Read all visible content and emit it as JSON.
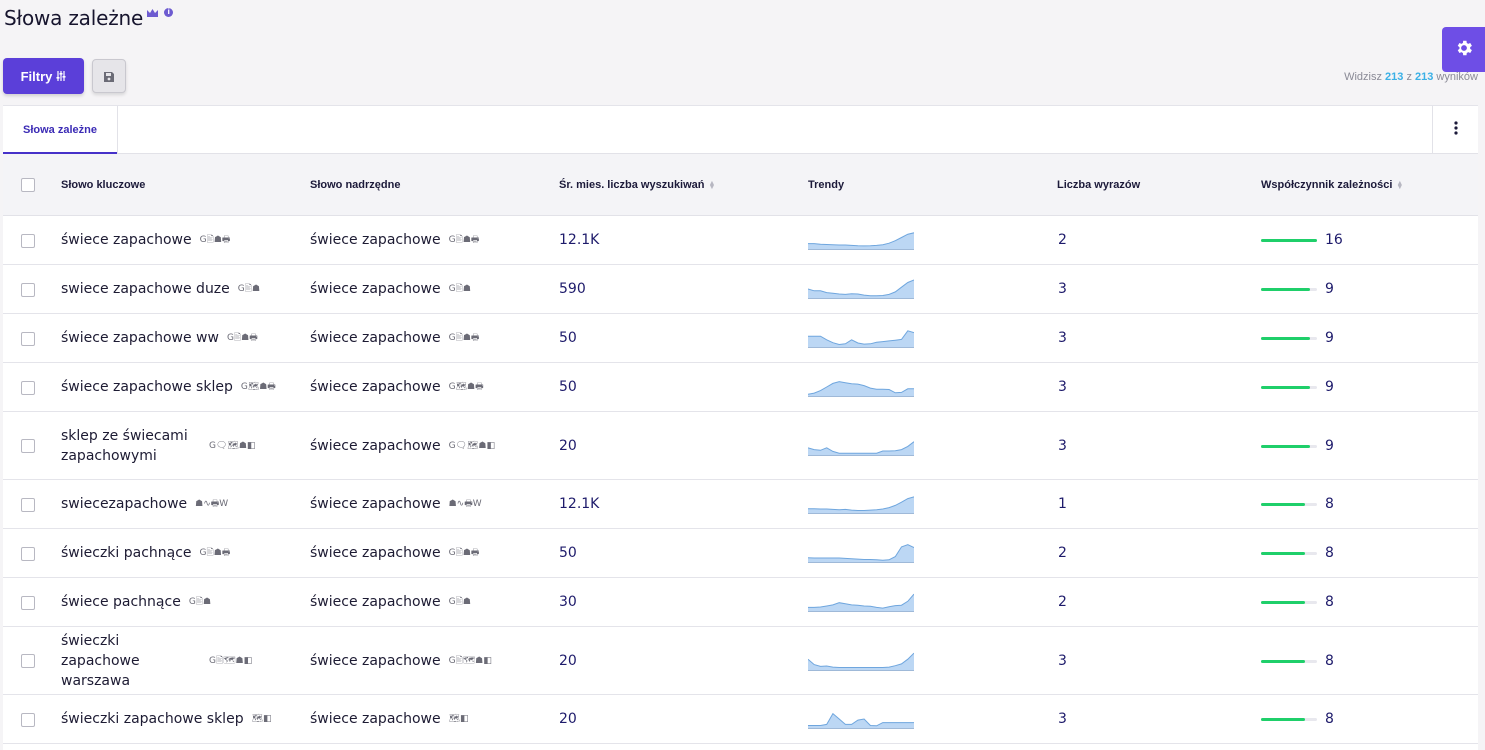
{
  "page": {
    "title": "Słowa zależne",
    "crown_icon": "crown-icon",
    "info_icon": "info-icon"
  },
  "toolbar": {
    "filters_label": "Filtry",
    "filters_icon": "sliders-icon",
    "save_icon": "floppy-disk-icon",
    "settings_icon": "gear-icon"
  },
  "results": {
    "prefix": "Widzisz",
    "shown": "213",
    "sep": "z",
    "total": "213",
    "suffix": "wyników"
  },
  "tabs": [
    {
      "label": "Słowa zależne",
      "active": true
    }
  ],
  "table": {
    "headers": {
      "keyword": "Słowo kluczowe",
      "parent": "Słowo nadrzędne",
      "volume": "Śr. mies. liczba wyszukiwań",
      "trends": "Trendy",
      "word_count": "Liczba wyrazów",
      "dependency": "Współczynnik zależności"
    },
    "rows": [
      {
        "keyword": "świece zapachowe",
        "kw_serp": "G🖹☗🖶",
        "parent": "świece zapachowe",
        "parent_serp": "G🖹☗🖶",
        "volume": "12.1K",
        "words": "2",
        "dep": "16",
        "dep_fill": 1.0,
        "trend": [
          3,
          3,
          2.6,
          2.5,
          2.4,
          2.2,
          2.2,
          2,
          1.8,
          1.7,
          1.8,
          2,
          2.4,
          3.2,
          4.6,
          6.4,
          8.2,
          9
        ]
      },
      {
        "keyword": "swiece zapachowe duze",
        "kw_serp": "G🖹☗",
        "parent": "świece zapachowe",
        "parent_serp": "G🖹☗",
        "volume": "590",
        "words": "3",
        "dep": "9",
        "dep_fill": 0.88,
        "trend": [
          5,
          4,
          4,
          3,
          2.6,
          2.2,
          2,
          2.4,
          2.2,
          1.6,
          1.2,
          1.2,
          1.4,
          2,
          3.4,
          6,
          8.6,
          10
        ]
      },
      {
        "keyword": "świece zapachowe ww",
        "kw_serp": "G🖹☗🖶",
        "parent": "świece zapachowe",
        "parent_serp": "G🖹☗🖶",
        "volume": "50",
        "words": "3",
        "dep": "9",
        "dep_fill": 0.88,
        "trend": [
          6,
          6,
          6,
          4,
          2.4,
          1.4,
          1.8,
          4,
          2.2,
          1.6,
          1.8,
          2.6,
          3,
          3.4,
          3.8,
          4.2,
          9,
          8
        ]
      },
      {
        "keyword": "świece zapachowe sklep",
        "kw_serp": "G🗺☗🖶",
        "parent": "świece zapachowe",
        "parent_serp": "G🗺☗🖶",
        "volume": "50",
        "words": "3",
        "dep": "9",
        "dep_fill": 0.88,
        "trend": [
          1,
          1.6,
          3,
          5,
          7,
          8,
          7.4,
          6.8,
          6.6,
          5.8,
          4.4,
          3.8,
          3.8,
          3.6,
          1.8,
          2,
          4,
          4
        ]
      },
      {
        "keyword": "sklep ze świecami zapachowymi",
        "kw_serp": "G🗨🗺☗◧",
        "parent": "świece zapachowe",
        "parent_serp": "G🗨🗺☗◧",
        "volume": "20",
        "words": "3",
        "dep": "9",
        "dep_fill": 0.88,
        "trend": [
          4,
          3,
          2.6,
          4,
          2,
          1,
          1,
          1,
          1,
          1,
          1,
          1,
          2.2,
          2.2,
          2.4,
          3,
          4.8,
          7.4
        ]
      },
      {
        "keyword": "swiecezapachowe",
        "kw_serp": "☗∿🖶W",
        "parent": "świece zapachowe",
        "parent_serp": "☗∿🖶W",
        "volume": "12.1K",
        "words": "1",
        "dep": "8",
        "dep_fill": 0.78,
        "trend": [
          2.4,
          2.4,
          2.2,
          2.2,
          2,
          1.8,
          2,
          1.6,
          1.4,
          1.4,
          1.6,
          1.8,
          2.2,
          3,
          4.2,
          6,
          8,
          9
        ]
      },
      {
        "keyword": "świeczki pachnące",
        "kw_serp": "G🖹☗🖶",
        "parent": "świece zapachowe",
        "parent_serp": "G🖹☗🖶",
        "volume": "50",
        "words": "2",
        "dep": "8",
        "dep_fill": 0.78,
        "trend": [
          2.4,
          2.2,
          2.2,
          2.2,
          2.2,
          2.2,
          2,
          1.8,
          1.6,
          1.4,
          1.4,
          1.2,
          1,
          1.2,
          3,
          8.4,
          9.6,
          8
        ]
      },
      {
        "keyword": "świece pachnące",
        "kw_serp": "G🖹☗",
        "parent": "świece zapachowe",
        "parent_serp": "G🖹☗",
        "volume": "30",
        "words": "2",
        "dep": "8",
        "dep_fill": 0.78,
        "trend": [
          2,
          2,
          2.2,
          2.8,
          3.4,
          4.6,
          4,
          3.4,
          3.2,
          2.8,
          2.6,
          2,
          1.6,
          2.4,
          3,
          3.2,
          5.4,
          9.4
        ]
      },
      {
        "keyword": "świeczki zapachowe warszawa",
        "kw_serp": "G🖹🗺☗◧",
        "parent": "świece zapachowe",
        "parent_serp": "G🖹🗺☗◧",
        "volume": "20",
        "words": "3",
        "dep": "8",
        "dep_fill": 0.78,
        "trend": [
          6,
          3,
          2,
          2.2,
          1.6,
          1.4,
          1.4,
          1.4,
          1.4,
          1.4,
          1.4,
          1.4,
          1.4,
          1.6,
          2.4,
          3.4,
          6,
          9.4
        ]
      },
      {
        "keyword": "świeczki zapachowe sklep",
        "kw_serp": "🗺◧",
        "parent": "świece zapachowe",
        "parent_serp": "🗺◧",
        "volume": "20",
        "words": "3",
        "dep": "8",
        "dep_fill": 0.78,
        "trend": [
          1.4,
          1.4,
          1.4,
          2,
          8,
          5,
          2,
          2,
          4.4,
          5,
          1.4,
          1.2,
          3,
          3,
          3,
          3,
          3,
          3
        ]
      }
    ]
  },
  "colors": {
    "accent": "#5b3fd9",
    "trend_fill": "#bcd7f4",
    "trend_line": "#6fa6de",
    "dep_bar": "#1fcf6a",
    "count_highlight": "#3ab0e6"
  }
}
